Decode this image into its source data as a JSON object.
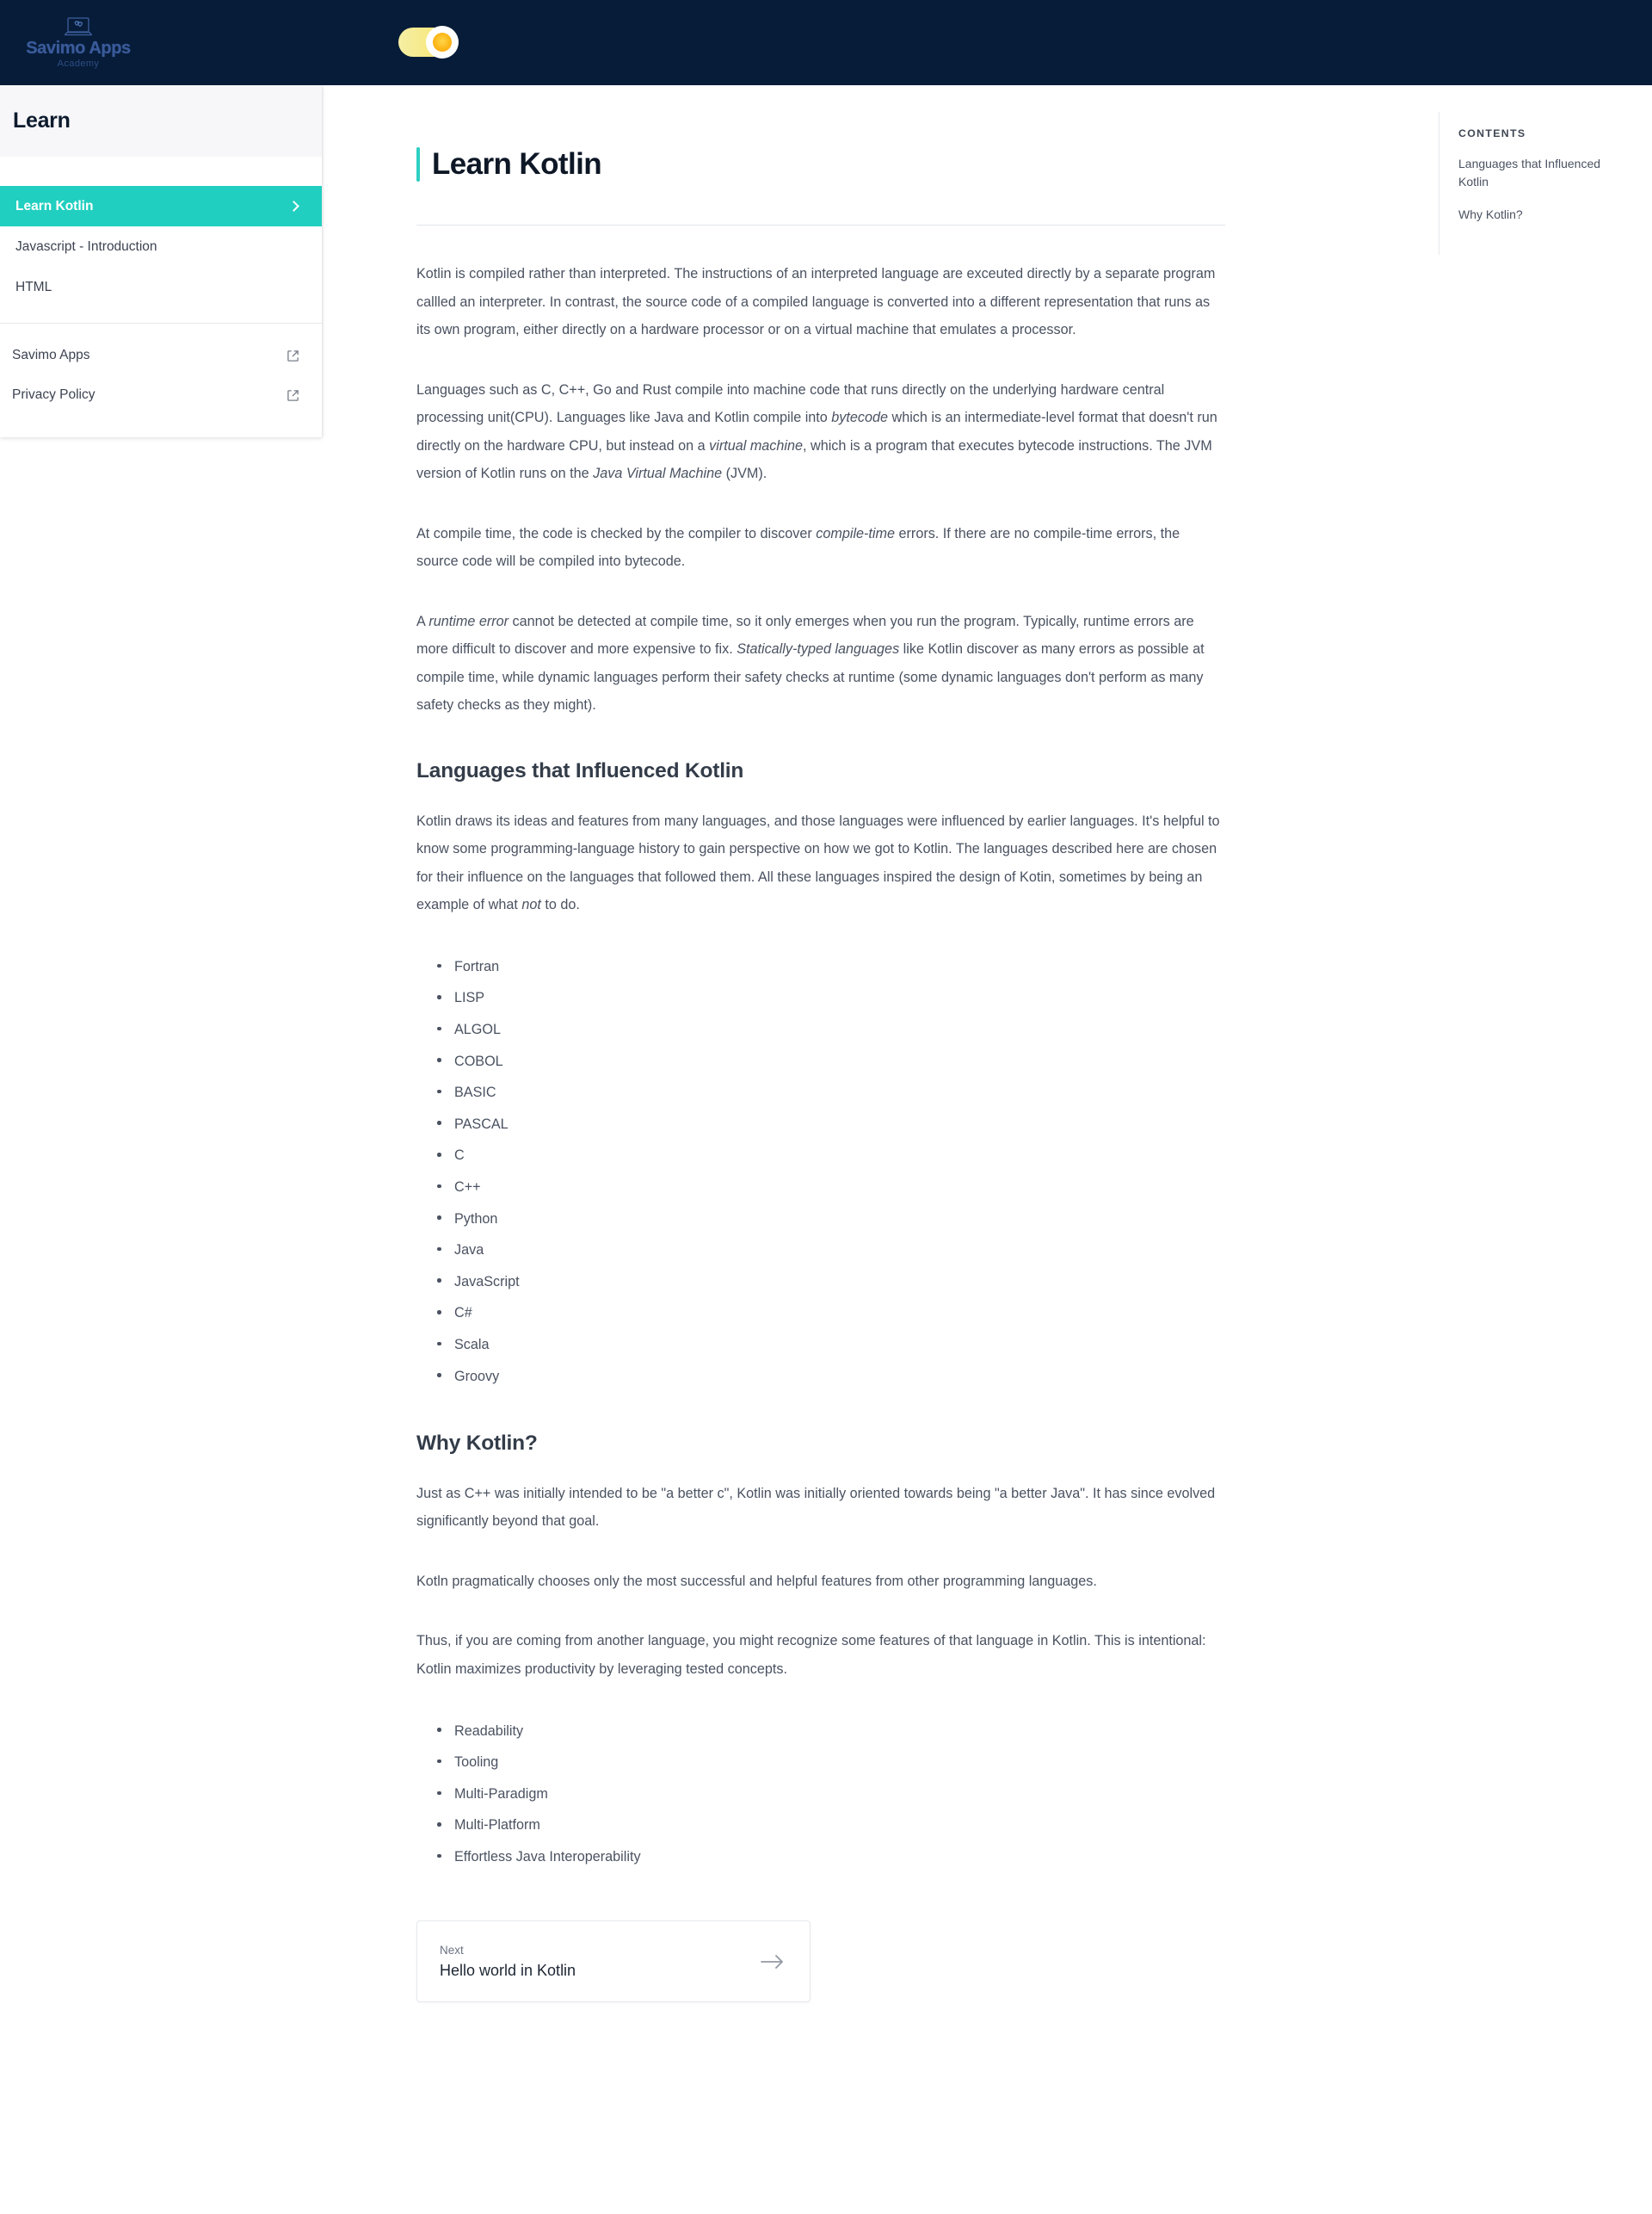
{
  "brand": {
    "title": "Savimo Apps",
    "subtitle": "Academy",
    "logo_icon": "laptop-hearts-icon"
  },
  "header": {
    "theme_toggle": {
      "state": "light",
      "icon": "sun-icon"
    }
  },
  "sidebar": {
    "heading": "Learn",
    "nav_items": [
      {
        "label": "Learn Kotlin",
        "active": true,
        "icon": "chevron-right-icon"
      },
      {
        "label": "Javascript - Introduction",
        "active": false
      },
      {
        "label": "HTML",
        "active": false
      }
    ],
    "external_links": [
      {
        "label": "Savimo Apps",
        "icon": "external-link-icon"
      },
      {
        "label": "Privacy Policy",
        "icon": "external-link-icon"
      }
    ]
  },
  "contents": {
    "heading": "CONTENTS",
    "links": [
      "Languages that Influenced Kotlin",
      "Why Kotlin?"
    ]
  },
  "article": {
    "title": "Learn Kotlin",
    "p1_a": "Kotlin is compiled rather than interpreted. The instructions of an interpreted language are exceuted directly by a separate program callled an interpreter. In contrast, the source code of a compiled language is converted into a different representation that runs as its own program, either directly on a hardware processor or on a virtual machine that emulates a processor.",
    "p2_a": "Languages such as C, C++, Go and Rust compile into machine code that runs directly on the underlying hardware central processing unit(CPU). Languages like Java and Kotlin compile into ",
    "p2_em1": "bytecode",
    "p2_b": " which is an intermediate-level format that doesn't run directly on the hardware CPU, but instead on a ",
    "p2_em2": "virtual machine",
    "p2_c": ", which is a program that executes bytecode instructions. The JVM version of Kotlin runs on the ",
    "p2_em3": "Java Virtual Machine",
    "p2_d": " (JVM).",
    "p3_a": "At compile time, the code is checked by the compiler to discover ",
    "p3_em1": "compile-time",
    "p3_b": " errors. If there are no compile-time errors, the source code will be compiled into bytecode.",
    "p4_a": "A ",
    "p4_em1": "runtime error",
    "p4_b": " cannot be detected at compile time, so it only emerges when you run the program. Typically, runtime errors are more difficult to discover and more expensive to fix. ",
    "p4_em2": "Statically-typed languages",
    "p4_c": " like Kotlin discover as many errors as possible at compile time, while dynamic languages perform their safety checks at runtime (some dynamic languages don't perform as many safety checks as they might).",
    "section1_title": "Languages that Influenced Kotlin",
    "p5_a": "Kotlin draws its ideas and features from many languages, and those languages were influenced by earlier languages. It's helpful to know some programming-language history to gain perspective on how we got to Kotlin. The languages described here are chosen for their influence on the languages that followed them. All these languages inspired the design of Kotin, sometimes by being an example of what ",
    "p5_em1": "not",
    "p5_b": " to do.",
    "languages_list": [
      "Fortran",
      "LISP",
      "ALGOL",
      "COBOL",
      "BASIC",
      "PASCAL",
      "C",
      "C++",
      "Python",
      "Java",
      "JavaScript",
      "C#",
      "Scala",
      "Groovy"
    ],
    "section2_title": "Why Kotlin?",
    "p6": "Just as C++ was initially intended to be \"a better c\", Kotlin was initially oriented towards being \"a better Java\". It has since evolved significantly beyond that goal.",
    "p7": "Kotln pragmatically chooses only the most successful and helpful features from other programming languages.",
    "p8": "Thus, if you are coming from another language, you might recognize some features of that language in Kotlin. This is intentional: Kotlin maximizes productivity by leveraging tested concepts.",
    "features_list": [
      "Readability",
      "Tooling",
      "Multi-Paradigm",
      "Multi-Platform",
      "Effortless Java Interoperability"
    ]
  },
  "next_card": {
    "label": "Next",
    "title": "Hello world in Kotlin",
    "icon": "arrow-right-icon"
  },
  "colors": {
    "header_bg": "#061c38",
    "accent_teal": "#21cfc0",
    "toggle_yellow": "#f5e36a",
    "text_body": "#4a5261"
  }
}
